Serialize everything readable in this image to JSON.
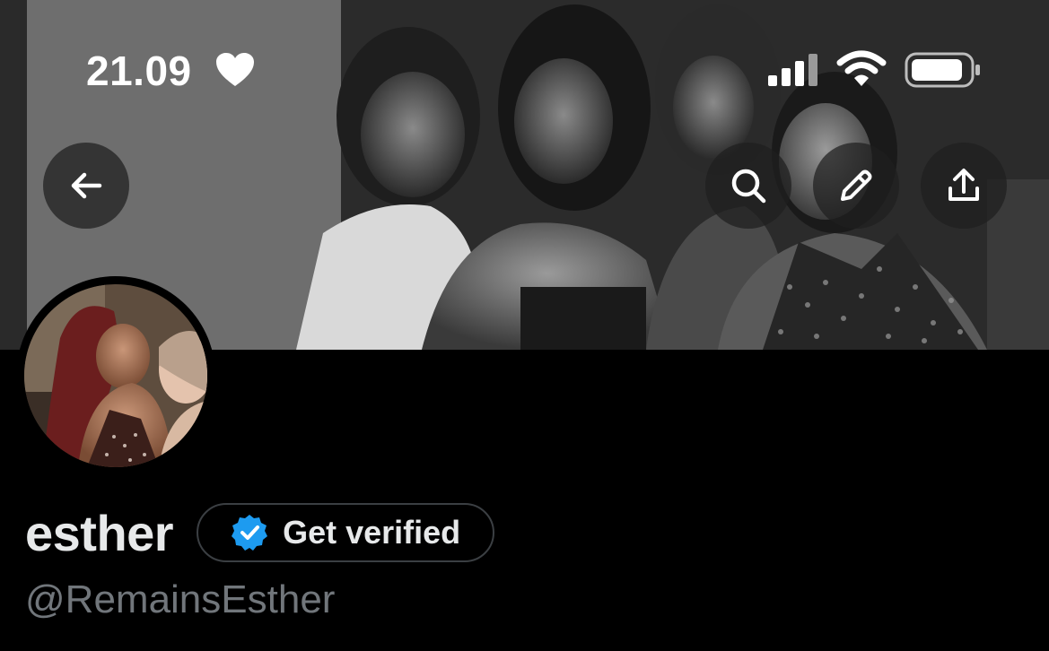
{
  "status_bar": {
    "time": "21.09",
    "heart_icon": "heart-icon",
    "signal_icon": "cellular-signal-icon",
    "wifi_icon": "wifi-icon",
    "battery_icon": "battery-icon"
  },
  "header_actions": {
    "back_icon": "arrow-left-icon",
    "search_icon": "search-icon",
    "edit_icon": "pencil-icon",
    "share_icon": "share-upload-icon"
  },
  "profile": {
    "display_name": "esther",
    "get_verified_label": "Get verified",
    "handle": "@RemainsEsther"
  },
  "colors": {
    "background": "#000000",
    "name_text": "#e7e9ea",
    "handle_text": "#71767b",
    "verified_blue": "#1d9bf0",
    "button_border": "#3b3f43"
  }
}
